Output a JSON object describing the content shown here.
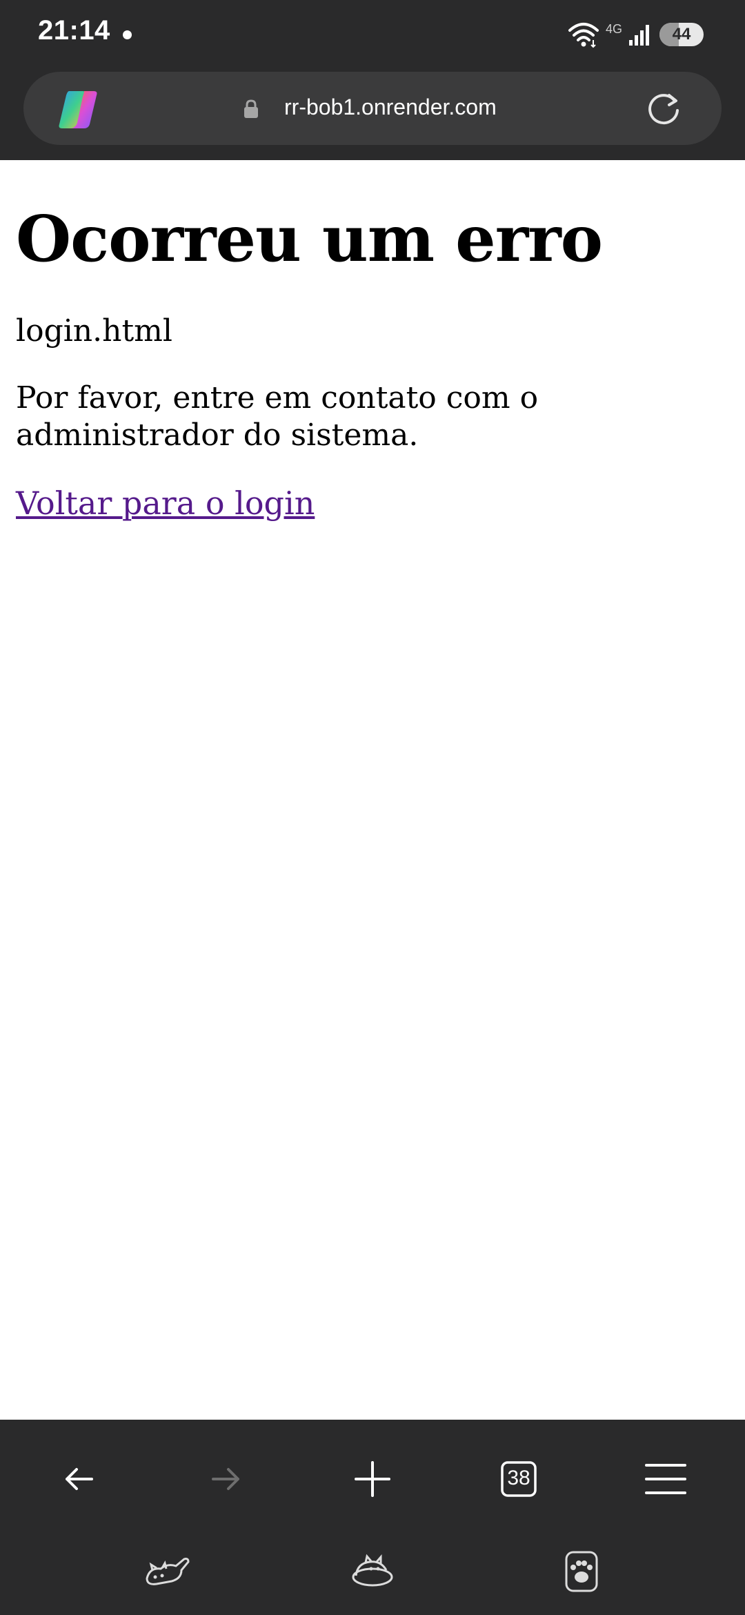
{
  "status_bar": {
    "time": "21:14",
    "network_label": "4G",
    "battery_level": "44",
    "battery_fraction": 0.44
  },
  "browser": {
    "url": "rr-bob1.onrender.com",
    "tab_count": "38"
  },
  "page": {
    "title": "Ocorreu um erro",
    "error_detail": "login.html",
    "message": "Por favor, entre em contato com o administrador do sistema.",
    "back_link": "Voltar para o login"
  },
  "colors": {
    "chrome_bg": "#2a2a2b",
    "url_bar_bg": "#3b3b3c",
    "link_visited": "#551a8b"
  },
  "icons": {
    "status": [
      "wifi-icon",
      "signal-icon",
      "battery-icon"
    ],
    "toolbar": [
      "copilot-icon",
      "lock-icon",
      "reload-icon"
    ],
    "nav": [
      "back-arrow-icon",
      "forward-arrow-icon",
      "new-tab-icon",
      "tabs-icon",
      "menu-icon"
    ],
    "extras": [
      "cat-sleeping-icon",
      "cat-bowl-icon",
      "paw-print-icon"
    ]
  }
}
